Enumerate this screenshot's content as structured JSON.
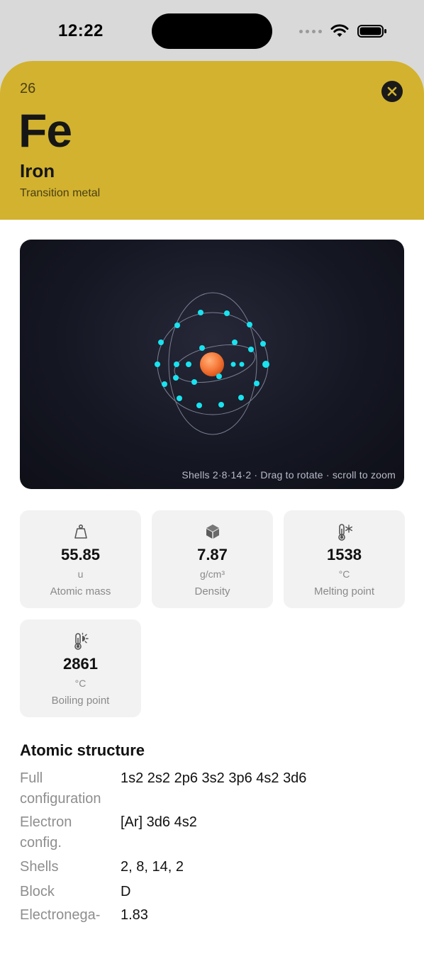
{
  "status_bar": {
    "time": "12:22"
  },
  "element": {
    "atomic_number": "26",
    "symbol": "Fe",
    "name": "Iron",
    "category": "Transition metal",
    "accent_color": "#d2b22f"
  },
  "viewer": {
    "caption": "Shells 2·8·14·2  ·  Drag to rotate · scroll to zoom"
  },
  "properties": [
    {
      "icon": "weight-icon",
      "value": "55.85",
      "unit": "u",
      "label": "Atomic mass"
    },
    {
      "icon": "cube-icon",
      "value": "7.87",
      "unit": "g/cm³",
      "label": "Density"
    },
    {
      "icon": "thermometer-snowflake-icon",
      "value": "1538",
      "unit": "°C",
      "label": "Melting point"
    },
    {
      "icon": "thermometer-sun-icon",
      "value": "2861",
      "unit": "°C",
      "label": "Boiling point"
    }
  ],
  "structure": {
    "title": "Atomic structure",
    "rows": [
      {
        "label": "Full configuration",
        "value": "1s2 2s2 2p6 3s2 3p6 4s2 3d6"
      },
      {
        "label": "Electron config.",
        "value": "[Ar] 3d6 4s2"
      },
      {
        "label": "Shells",
        "value": "2, 8, 14, 2"
      },
      {
        "label": "Block",
        "value": "D"
      },
      {
        "label": "Electronega-",
        "value": "1.83"
      }
    ]
  }
}
